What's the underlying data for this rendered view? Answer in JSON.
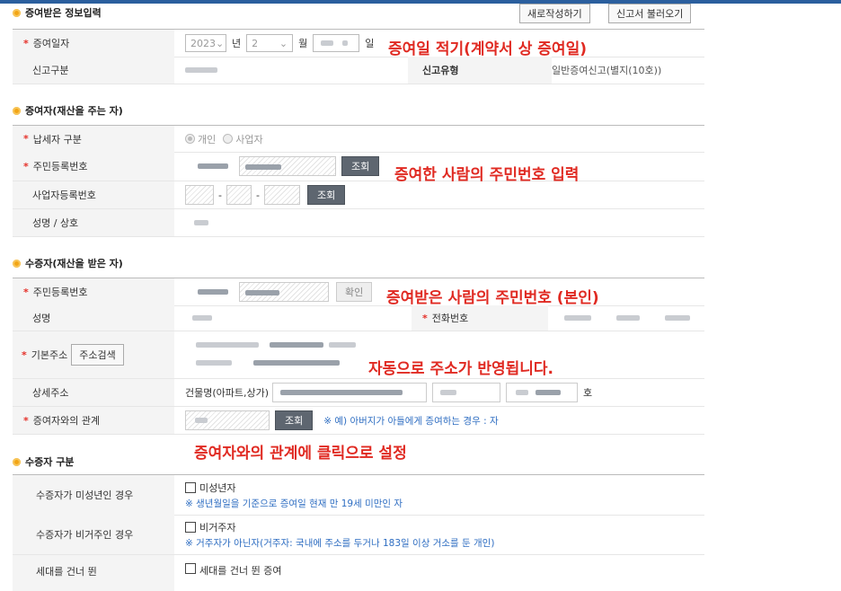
{
  "header": {
    "section1_title": "증여받은 정보입력",
    "new_button": "새로작성하기",
    "load_button": "신고서 불러오기"
  },
  "gift_info": {
    "date_label": "증여일자",
    "year_value": "2023",
    "year_unit": "년",
    "month_value": "2",
    "month_unit": "월",
    "day_unit": "일",
    "report_type_label": "신고구분",
    "report_kind_label": "신고유형",
    "report_kind_value": "일반증여신고(별지(10호))"
  },
  "donor": {
    "title": "증여자(재산을 주는 자)",
    "taxpayer_label": "납세자 구분",
    "opt_individual": "개인",
    "opt_business": "사업자",
    "rrn_label": "주민등록번호",
    "lookup_button": "조회",
    "bizno_label": "사업자등록번호",
    "dash": "-",
    "name_label": "성명 / 상호"
  },
  "donee": {
    "title": "수증자(재산을 받은 자)",
    "rrn_label": "주민등록번호",
    "confirm_button": "확인",
    "name_label": "성명",
    "phone_label": "전화번호",
    "address_label": "기본주소",
    "address_search_button": "주소검색",
    "detail_label": "상세주소",
    "building_label": "건물명(아파트,상가)",
    "ho_unit": "호",
    "relation_label": "증여자와의 관계",
    "relation_lookup_button": "조회",
    "relation_note": "※ 예) 아버지가 아들에게 증여하는 경우 : 자"
  },
  "donee_type": {
    "title": "수증자 구분",
    "minor_label": "수증자가 미성년인 경우",
    "minor_check": "미성년자",
    "minor_note": "※ 생년월일을 기준으로 증여일 현재 만 19세 미만인 자",
    "nonres_label": "수증자가 비거주인 경우",
    "nonres_check": "비거주자",
    "nonres_note": "※ 거주자가 아닌자(거주자: 국내에 주소를 두거나 183일 이상 거소를 둔 개인)",
    "skip_label": "세대를 건너 뛴",
    "skip_check": "세대를 건너 뛴 증여"
  },
  "annotations": {
    "a1": "증여일 적기(계약서 상 증여일)",
    "a2": "증여한 사람의 주민번호 입력",
    "a3": "증여받은 사람의 주민번호 (본인)",
    "a4": "자동으로 주소가 반영됩니다.",
    "a5": "증여자와의 관계에 클릭으로 설정"
  },
  "colors": {
    "annotation": "#e02a22",
    "required": "#e5312a",
    "note": "#2f6ec2",
    "bullet": "#f2a516"
  }
}
